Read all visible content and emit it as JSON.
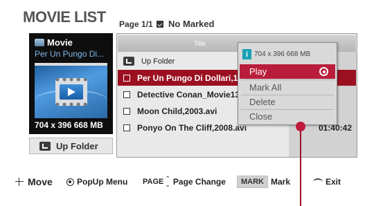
{
  "header": {
    "title": "MOVIE LIST",
    "page_info": "Page 1/1",
    "marked_text": "No Marked"
  },
  "preview": {
    "heading": "Movie",
    "filename": "Per Un Pungo Di...",
    "resolution": "704 x 396  668 MB"
  },
  "up_folder_button": "Up Folder",
  "list": {
    "column_title": "Title",
    "rows": [
      {
        "label": "Up Folder",
        "duration": "",
        "type": "folder"
      },
      {
        "label": "Per Un Pungo Di Dollari,19",
        "duration": "",
        "type": "file",
        "selected": true
      },
      {
        "label": "Detective Conan_Movie13-",
        "duration": "",
        "type": "file"
      },
      {
        "label": "Moon Child,2003.avi",
        "duration": "",
        "type": "file"
      },
      {
        "label": "Ponyo On The Cliff,2008.avi",
        "duration": "01:40:42",
        "type": "file"
      }
    ]
  },
  "popup": {
    "info_text": "704 x 396  668 MB",
    "items": [
      "Play",
      "Mark All",
      "Delete",
      "Close"
    ],
    "active_item": "Play"
  },
  "footer": {
    "move": "Move",
    "popup_menu": "PopUp Menu",
    "page_prefix": "PAGE",
    "page_change": "Page Change",
    "mark_badge": "MARK",
    "mark": "Mark",
    "exit": "Exit"
  },
  "colors": {
    "selected_row": "#9b1020",
    "popup_active": "#b91d3c",
    "info_icon": "#1aa1b6"
  }
}
